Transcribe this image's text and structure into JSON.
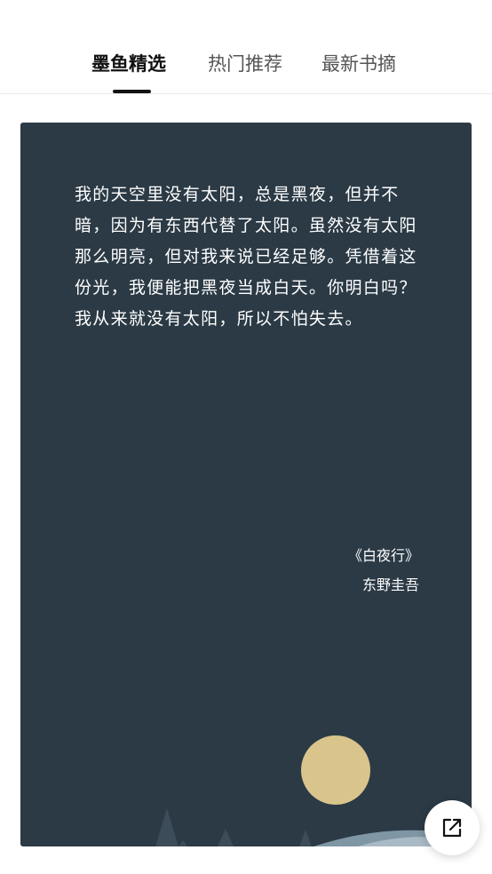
{
  "tabs": [
    {
      "label": "墨鱼精选",
      "active": true
    },
    {
      "label": "热门推荐",
      "active": false
    },
    {
      "label": "最新书摘",
      "active": false
    }
  ],
  "card": {
    "quote": "我的天空里没有太阳，总是黑夜，但并不暗，因为有东西代替了太阳。虽然没有太阳那么明亮，但对我来说已经足够。凭借着这份光，我便能把黑夜当成白天。你明白吗？我从来就没有太阳，所以不怕失去。",
    "book_title": "《白夜行》",
    "author": "东野圭吾",
    "background_color": "#2b3a45",
    "moon_color": "#d9c48c"
  },
  "share_button": {
    "icon": "external-share-icon"
  }
}
